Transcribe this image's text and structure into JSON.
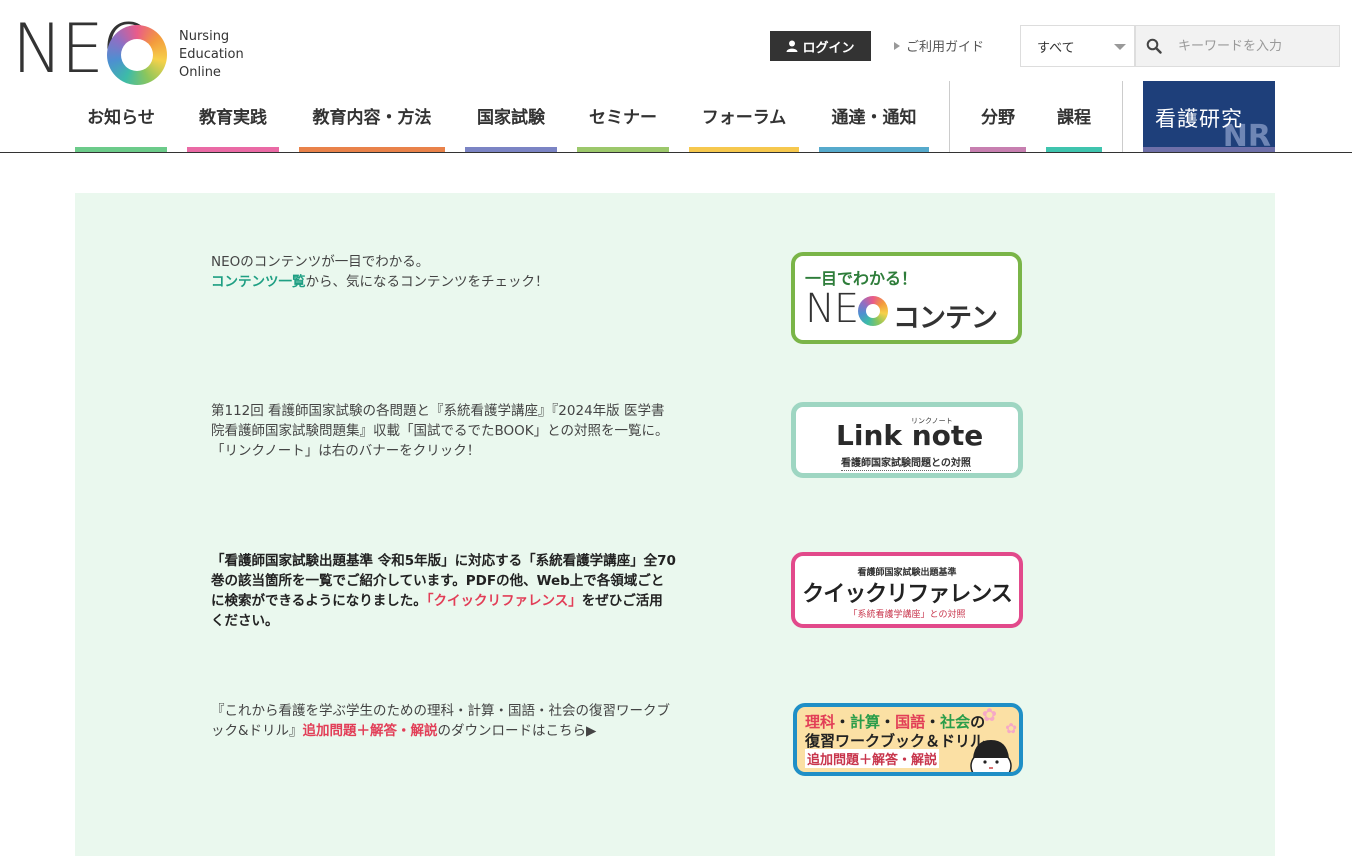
{
  "header": {
    "logo_text": "NEO",
    "logo_sub": [
      "Nursing",
      "Education",
      "Online"
    ],
    "login_label": "ログイン",
    "guide_label": "ご利用ガイド",
    "search_select": "すべて",
    "search_placeholder": "キーワードを入力"
  },
  "nav": {
    "items": [
      {
        "label": "お知らせ",
        "color": "#6ccb8a"
      },
      {
        "label": "教育実践",
        "color": "#ea6aa5"
      },
      {
        "label": "教育内容・方法",
        "color": "#e9824a"
      },
      {
        "label": "国家試験",
        "color": "#7b84c4"
      },
      {
        "label": "セミナー",
        "color": "#9cc86b"
      },
      {
        "label": "フォーラム",
        "color": "#f6c84e"
      },
      {
        "label": "通達・通知",
        "color": "#56aacc"
      },
      {
        "label": "分野",
        "color": "#c77fb0"
      },
      {
        "label": "課程",
        "color": "#3fc4ae"
      }
    ],
    "kango_label": "看護研究",
    "kango_sub": "NR"
  },
  "content": {
    "section1": {
      "line1": "NEOのコンテンツが一目でわかる。",
      "link": "コンテンツ一覧",
      "rest": "から、気になるコンテンツをチェック！",
      "banner_top": "一目でわかる！",
      "banner_neo": "NE",
      "banner_main": "コンテンツ"
    },
    "section2": {
      "text": "第112回 看護師国家試験の各問題と『系統看護学講座』『2024年版 医学書院看護師国家試験問題集』収載「国試でるでたBOOK」との対照を一覧に。「リンクノート」は右のバナーをクリック！",
      "banner_ruby": "リンクノート",
      "banner_main": "Link note",
      "banner_sub": "看護師国家試験問題との対照"
    },
    "section3": {
      "text_a": "「看護師国家試験出題基準 令和5年版」に対応する「系統看護学講座」全70巻の該当箇所を一覧でご紹介しています。PDFの他、Web上で各領域ごとに検索ができるようになりました。",
      "link": "「クイックリファレンス」",
      "text_b": "をぜひご活用ください。",
      "banner_top": "看護師国家試験出題基準",
      "banner_main": "クイックリファレンス",
      "banner_sub": "「系統看護学講座」との対照"
    },
    "section4": {
      "text_a": "『これから看護を学ぶ学生のための理科・計算・国語・社会の復習ワークブック&ドリル』",
      "link": "追加問題＋解答・解説",
      "text_b": "のダウンロードはこちら▶",
      "banner_w1": "理科",
      "banner_dot1": "・",
      "banner_w2": "計算",
      "banner_dot2": "・",
      "banner_w3": "国語",
      "banner_dot3": "・",
      "banner_w4": "社会",
      "banner_no": "の",
      "banner_l2": "復習ワークブック＆ドリル",
      "banner_l3": "追加問題＋解答・解説"
    }
  }
}
